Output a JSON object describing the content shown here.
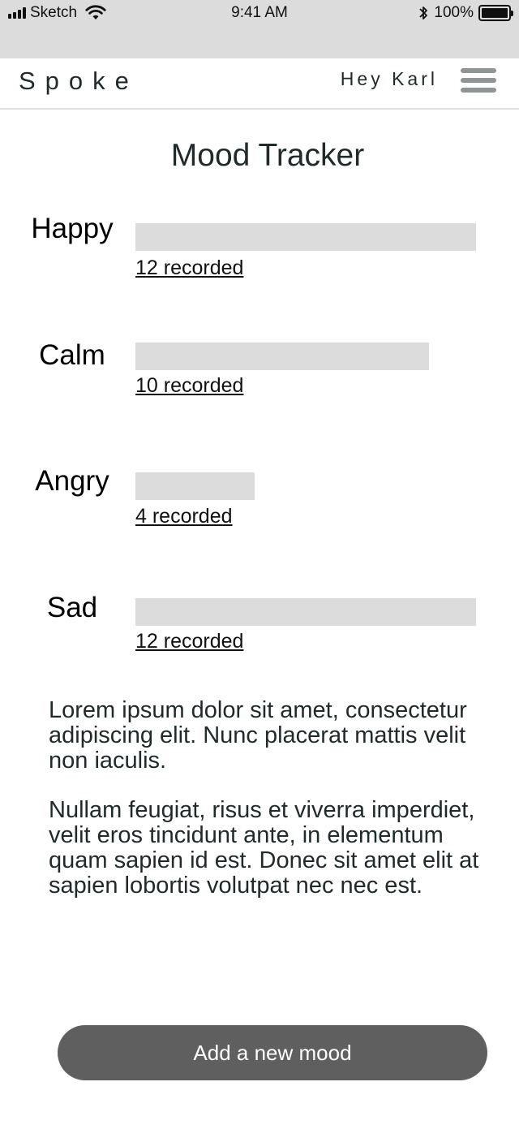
{
  "status_bar": {
    "carrier": "Sketch",
    "time": "9:41 AM",
    "battery_percent": "100%",
    "signal_icon": "signal-bars-icon",
    "wifi_icon": "wifi-icon",
    "bluetooth_icon": "bluetooth-icon",
    "battery_icon": "battery-full-icon"
  },
  "header": {
    "brand": "Spoke",
    "greeting": "Hey Karl",
    "menu_icon": "hamburger-menu-icon"
  },
  "page_title": "Mood Tracker",
  "moods": [
    {
      "label": "Happy",
      "count_text": "12 recorded",
      "count": 12
    },
    {
      "label": "Calm",
      "count_text": "10 recorded",
      "count": 10
    },
    {
      "label": "Angry",
      "count_text": "4 recorded",
      "count": 4
    },
    {
      "label": "Sad",
      "count_text": "12 recorded",
      "count": 12
    }
  ],
  "description": {
    "paragraph_1": "Lorem ipsum dolor sit amet, consectetur adipiscing elit. Nunc placerat mattis velit non iaculis.",
    "paragraph_2": "Nullam feugiat, risus et viverra imperdiet, velit eros tincidunt ante, in elementum quam sapien id est. Donec sit amet elit at sapien lobortis volutpat nec nec est."
  },
  "cta": {
    "label": "Add a new mood"
  },
  "colors": {
    "status_bar_bg": "#dcdcdc",
    "bar_fill": "#dcdcdc",
    "text": "#1f2a2a",
    "button_bg": "#5f5f5f",
    "menu_icon": "#8f9494"
  }
}
